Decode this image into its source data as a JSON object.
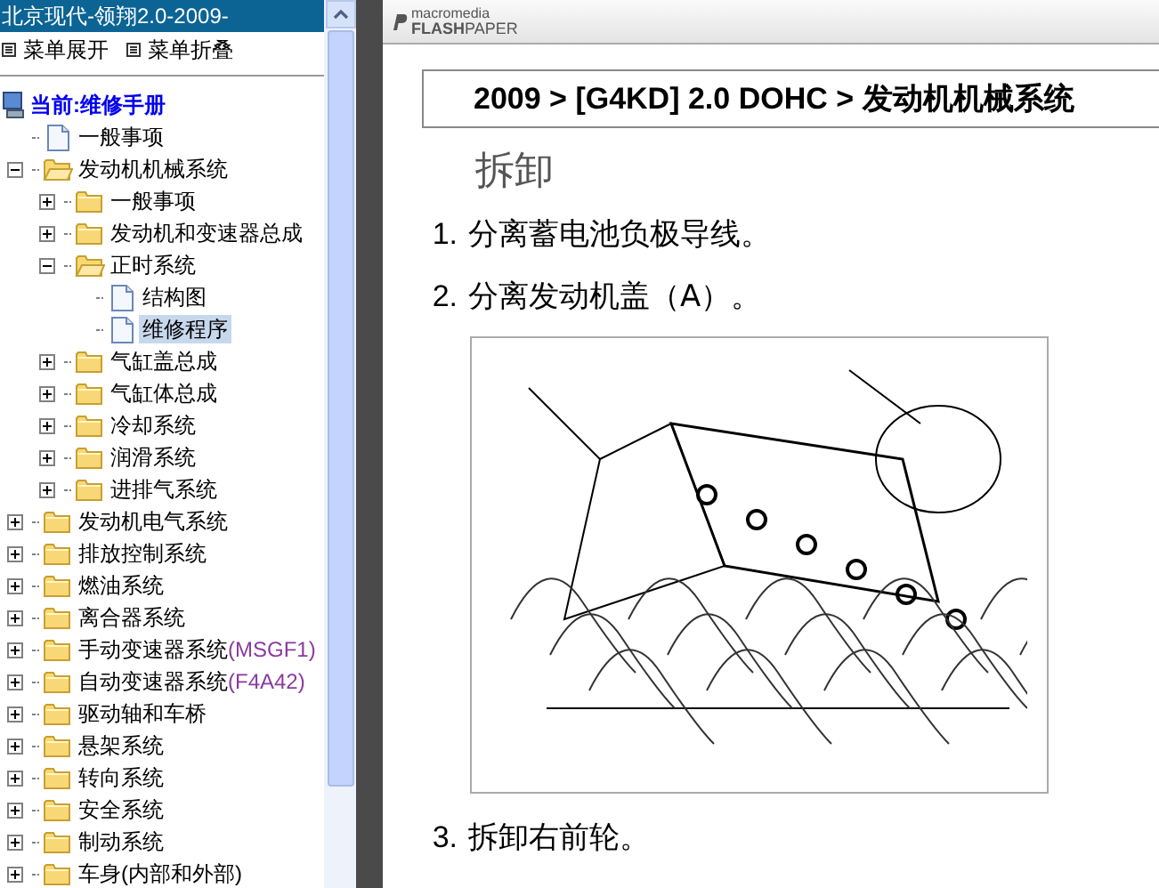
{
  "window": {
    "title": "北京现代-领翔2.0-2009-"
  },
  "menu": [
    {
      "label": "菜单展开"
    },
    {
      "label": "菜单折叠"
    }
  ],
  "tree": {
    "root": "当前:维修手册",
    "items": [
      {
        "kind": "doc",
        "label": "一般事项",
        "selected": false
      },
      {
        "kind": "folder",
        "label": "发动机机械系统",
        "expanded": true,
        "children": [
          {
            "kind": "folder",
            "label": "一般事项",
            "expanded": false
          },
          {
            "kind": "folder",
            "label": "发动机和变速器总成",
            "expanded": false
          },
          {
            "kind": "folder",
            "label": "正时系统",
            "expanded": true,
            "children": [
              {
                "kind": "doc",
                "label": "结构图",
                "selected": false
              },
              {
                "kind": "doc",
                "label": "维修程序",
                "selected": true
              }
            ]
          },
          {
            "kind": "folder",
            "label": "气缸盖总成",
            "expanded": false
          },
          {
            "kind": "folder",
            "label": "气缸体总成",
            "expanded": false
          },
          {
            "kind": "folder",
            "label": "冷却系统",
            "expanded": false
          },
          {
            "kind": "folder",
            "label": "润滑系统",
            "expanded": false
          },
          {
            "kind": "folder",
            "label": "进排气系统",
            "expanded": false
          }
        ]
      },
      {
        "kind": "folder",
        "label": "发动机电气系统",
        "expanded": false
      },
      {
        "kind": "folder",
        "label": "排放控制系统",
        "expanded": false
      },
      {
        "kind": "folder",
        "label": "燃油系统",
        "expanded": false
      },
      {
        "kind": "folder",
        "label": "离合器系统",
        "expanded": false
      },
      {
        "kind": "folder",
        "label": "手动变速器系统",
        "suffix": "(MSGF1)",
        "expanded": false
      },
      {
        "kind": "folder",
        "label": "自动变速器系统",
        "suffix": "(F4A42)",
        "expanded": false
      },
      {
        "kind": "folder",
        "label": "驱动轴和车桥",
        "expanded": false
      },
      {
        "kind": "folder",
        "label": "悬架系统",
        "expanded": false
      },
      {
        "kind": "folder",
        "label": "转向系统",
        "expanded": false
      },
      {
        "kind": "folder",
        "label": "安全系统",
        "expanded": false
      },
      {
        "kind": "folder",
        "label": "制动系统",
        "expanded": false
      },
      {
        "kind": "folder",
        "label": "车身(内部和外部)",
        "expanded": false
      }
    ]
  },
  "viewer": {
    "logo_top": "macromedia",
    "logo_bold": "FLASH",
    "logo_rest": "PAPER"
  },
  "document": {
    "breadcrumb": "2009 > [G4KD] 2.0 DOHC > 发动机机械系统",
    "heading": "拆卸",
    "steps": [
      {
        "kind": "text",
        "number": "1.",
        "text": "分离蓄电池负极导线。"
      },
      {
        "kind": "text",
        "number": "2.",
        "text": "分离发动机盖（A）。"
      },
      {
        "kind": "figure"
      },
      {
        "kind": "text",
        "number": "3.",
        "text": "拆卸右前轮。"
      }
    ]
  }
}
